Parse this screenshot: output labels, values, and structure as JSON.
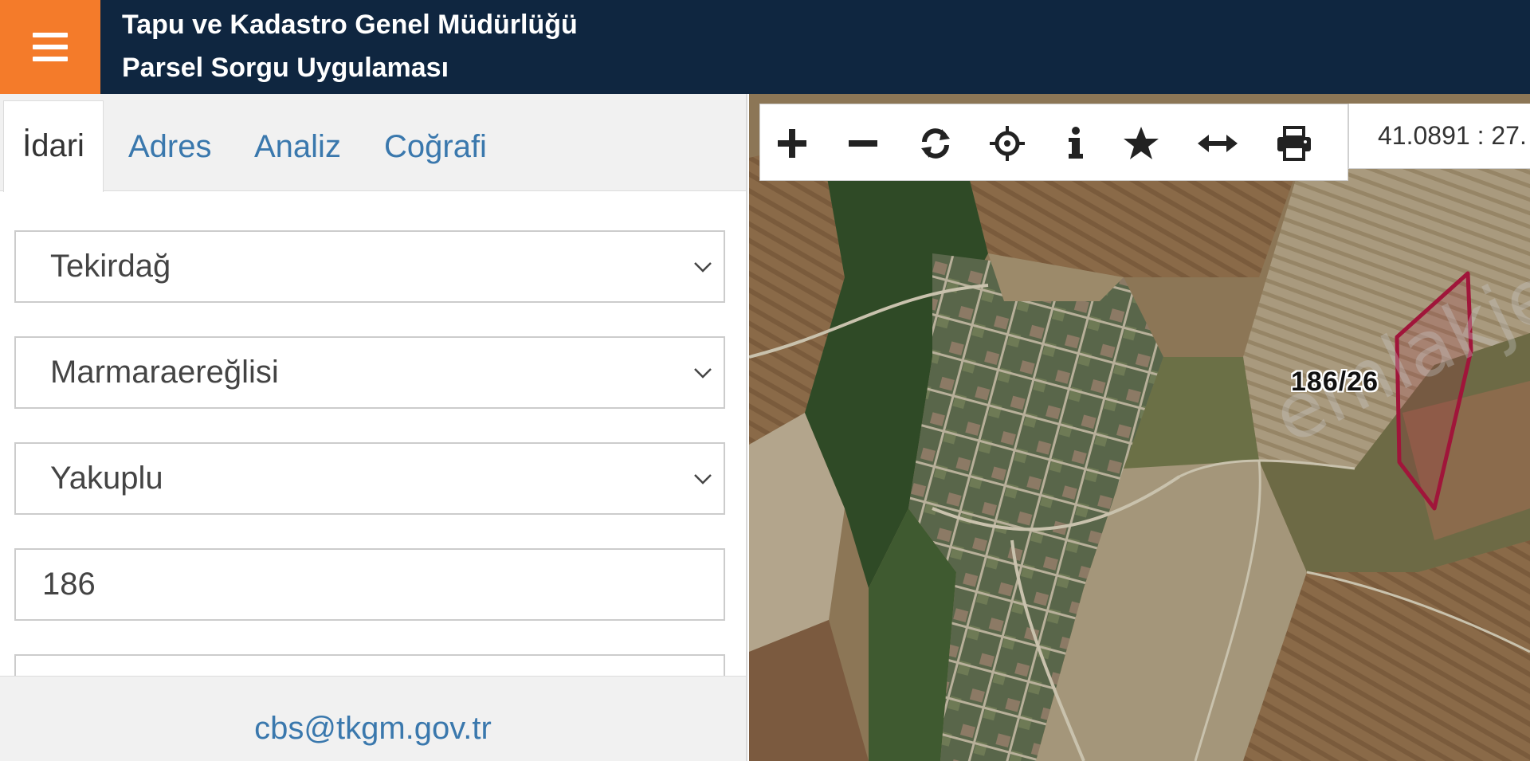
{
  "header": {
    "title_line1": "Tapu ve Kadastro Genel Müdürlüğü",
    "title_line2": "Parsel Sorgu Uygulaması",
    "menu_icon": "hamburger-menu-icon",
    "accent_color": "#f47b2a",
    "bar_color": "#0f2640"
  },
  "tabs": [
    {
      "label": "İdari",
      "active": true
    },
    {
      "label": "Adres",
      "active": false
    },
    {
      "label": "Analiz",
      "active": false
    },
    {
      "label": "Coğrafi",
      "active": false
    }
  ],
  "form": {
    "il": "Tekirdağ",
    "ilce": "Marmaraereğlisi",
    "mahalle": "Yakuplu",
    "ada": "186",
    "parsel": ""
  },
  "footer": {
    "email": "cbs@tkgm.gov.tr"
  },
  "map": {
    "coordinates": "41.0891 : 27.",
    "parcel_label": "186/26",
    "parcel_color": "#a0153a",
    "tools": [
      "zoom-in-icon",
      "zoom-out-icon",
      "refresh-icon",
      "locate-icon",
      "info-icon",
      "favorite-star-icon",
      "measure-icon",
      "print-icon"
    ]
  },
  "watermark": "emlakjet.com"
}
